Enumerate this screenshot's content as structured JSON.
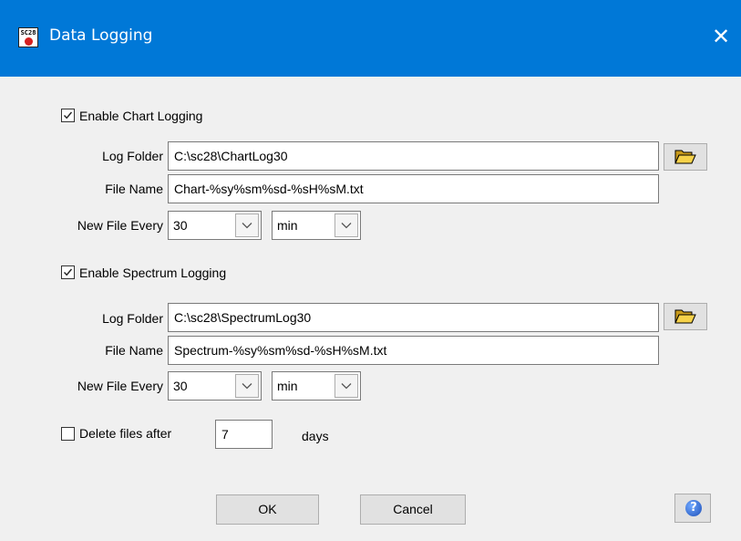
{
  "window": {
    "title": "Data Logging",
    "close_symbol": "✕",
    "app_icon_text": "SC28",
    "accent_color": "#0078d7"
  },
  "chart_logging": {
    "enabled": true,
    "label": "Enable Chart Logging",
    "log_folder_label": "Log Folder",
    "log_folder_value": "C:\\sc28\\ChartLog30",
    "file_name_label": "File Name",
    "file_name_value": "Chart-%sy%sm%sd-%sH%sM.txt",
    "new_file_every_label": "New File Every",
    "interval_value": "30",
    "unit_value": "min"
  },
  "spectrum_logging": {
    "enabled": true,
    "label": "Enable Spectrum Logging",
    "log_folder_label": "Log Folder",
    "log_folder_value": "C:\\sc28\\SpectrumLog30",
    "file_name_label": "File Name",
    "file_name_value": "Spectrum-%sy%sm%sd-%sH%sM.txt",
    "new_file_every_label": "New File Every",
    "interval_value": "30",
    "unit_value": "min"
  },
  "delete_files": {
    "enabled": false,
    "label": "Delete files after",
    "days_value": "7",
    "days_label": "days"
  },
  "buttons": {
    "ok_label": "OK",
    "cancel_label": "Cancel",
    "help_symbol": "?"
  },
  "icons": {
    "folder": "folder-open-icon",
    "dropdown": "chevron-down-icon",
    "help": "help-icon",
    "check": "checkmark-icon"
  }
}
